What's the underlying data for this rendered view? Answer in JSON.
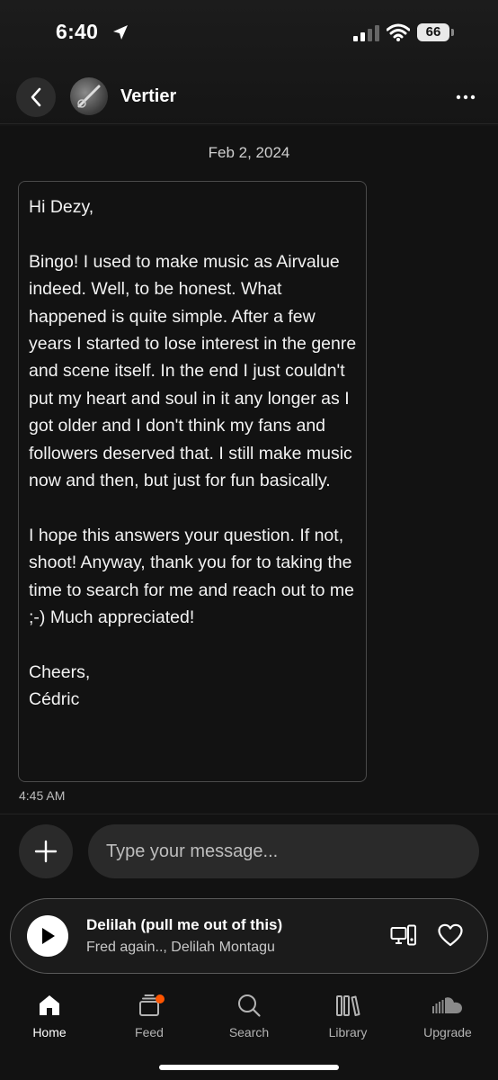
{
  "status_bar": {
    "time": "6:40",
    "battery": "66"
  },
  "header": {
    "title": "Vertier"
  },
  "conversation": {
    "date": "Feb 2, 2024",
    "message": "Hi Dezy,\n\nBingo! I used to make music as Airvalue indeed. Well, to be honest. What happened is quite simple. After a few years I started to lose interest in the genre and scene itself. In the end I just couldn't put my heart and soul in it any longer as I got older and I don't think my fans and followers deserved that. I still make music now and then, but just for fun basically.\n\nI hope this answers your question. If not, shoot! Anyway, thank you for to taking the time to search for me and reach out to me ;-) Much appreciated!\n\nCheers,\nCédric",
    "time": "4:45 AM"
  },
  "composer": {
    "placeholder": "Type your message..."
  },
  "player": {
    "title": "Delilah (pull me out of this)",
    "artist": "Fred again.., Delilah Montagu"
  },
  "tabs": [
    {
      "label": "Home",
      "icon": "home-icon",
      "active": true
    },
    {
      "label": "Feed",
      "icon": "feed-icon",
      "badge": true
    },
    {
      "label": "Search",
      "icon": "search-icon"
    },
    {
      "label": "Library",
      "icon": "library-icon"
    },
    {
      "label": "Upgrade",
      "icon": "soundcloud-icon"
    }
  ],
  "colors": {
    "background": "#121212",
    "badge": "#ff5500",
    "surface": "#2a2a2a"
  }
}
